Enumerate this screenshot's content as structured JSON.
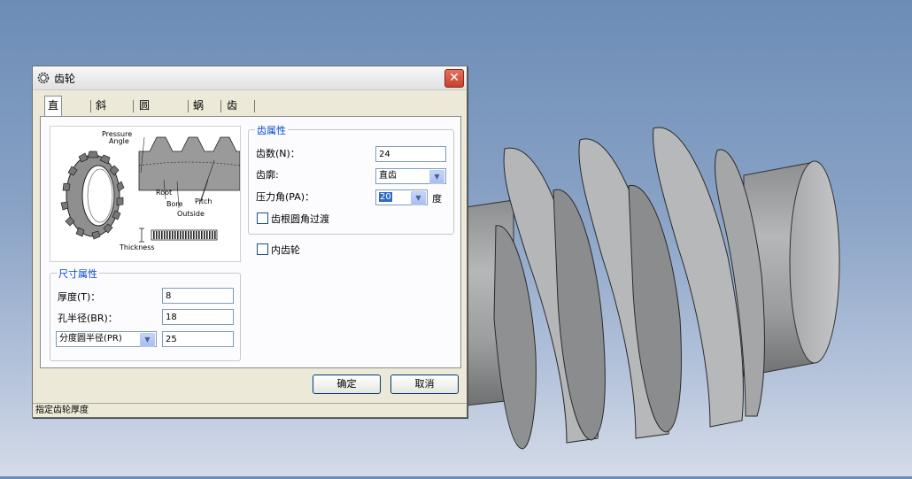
{
  "dialog": {
    "title": "齿轮",
    "close_label": "✕",
    "tabs": [
      {
        "label": "直齿轮",
        "active": true
      },
      {
        "label": "斜齿轮",
        "active": false
      },
      {
        "label": "圆锥齿轮",
        "active": false
      },
      {
        "label": "蜗杆",
        "active": false
      },
      {
        "label": "齿条",
        "active": false
      }
    ],
    "diagram": {
      "pressure_angle": "Pressure Angle",
      "pressure_line1": "Pressure",
      "pressure_line2": "Angle",
      "root": "Root",
      "bore": "Bore",
      "pitch": "Pitch",
      "outside": "Outside",
      "thickness": "Thickness"
    },
    "tooth_props": {
      "title": "齿属性",
      "teeth_label": "齿数(N)：",
      "teeth_value": "24",
      "profile_label": "齿廓:",
      "profile_value": "直齿",
      "pressure_label": "压力角(PA)：",
      "pressure_value": "20",
      "pressure_unit": "度",
      "root_fillet_label": "齿根圆角过渡",
      "root_fillet_checked": false
    },
    "internal_gear_label": "内齿轮",
    "internal_gear_checked": false,
    "size_props": {
      "title": "尺寸属性",
      "thickness_label": "厚度(T)：",
      "thickness_value": "8",
      "bore_label": "孔半径(BR)：",
      "bore_value": "18",
      "radius_select": "分度圆半径(PR)",
      "radius_value": "25"
    },
    "ok_label": "确定",
    "cancel_label": "取消",
    "status": "指定齿轮厚度"
  },
  "colors": {
    "background_top": "#6c8cb6",
    "background_bottom": "#d4dbe8",
    "group_title": "#0046d5",
    "close_button": "#c6412a",
    "worm_gray": "#9a9c9e"
  },
  "icons": [
    "gear-icon",
    "close-icon",
    "chevron-down-icon"
  ]
}
